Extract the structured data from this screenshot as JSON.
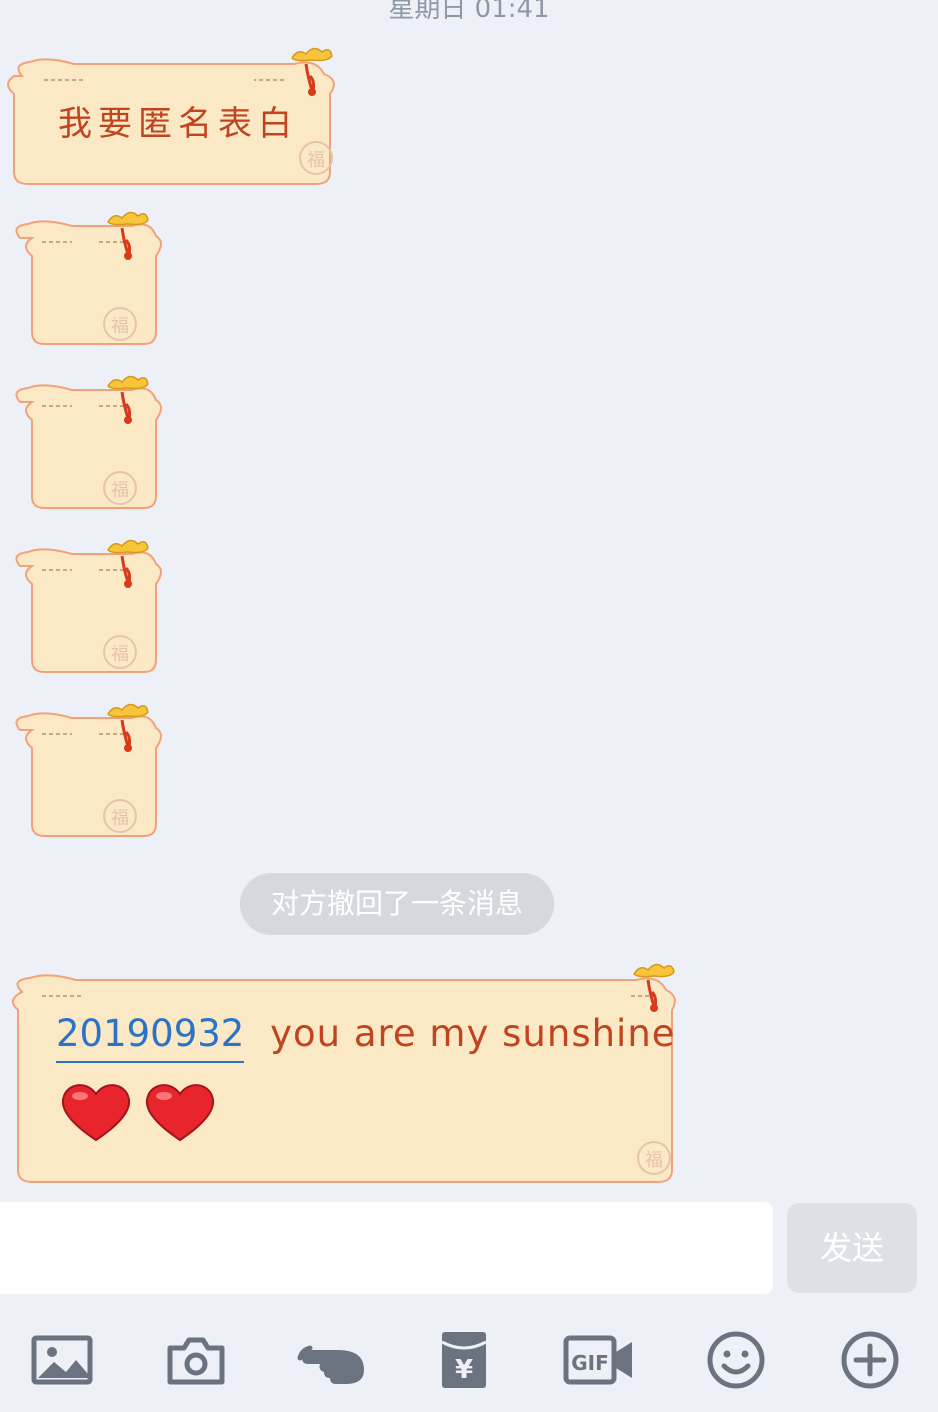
{
  "header": {
    "timestamp": "星期日 01:41"
  },
  "messages": [
    {
      "type": "pouch",
      "text": "我要匿名表白"
    },
    {
      "type": "pouch",
      "text": ""
    },
    {
      "type": "pouch",
      "text": ""
    },
    {
      "type": "pouch",
      "text": ""
    },
    {
      "type": "pouch",
      "text": ""
    },
    {
      "type": "system",
      "text": "对方撤回了一条消息"
    },
    {
      "type": "pouch",
      "mention": "20190932",
      "text": "you are my sunshine",
      "emojis": [
        "heart-emoji",
        "heart-emoji"
      ]
    }
  ],
  "input": {
    "value": "",
    "placeholder": ""
  },
  "send_button": {
    "label": "发送"
  },
  "toolbar": {
    "items": [
      {
        "icon": "image-icon"
      },
      {
        "icon": "camera-icon"
      },
      {
        "icon": "poke-icon"
      },
      {
        "icon": "red-packet-icon"
      },
      {
        "icon": "gif-icon"
      },
      {
        "icon": "emoji-icon"
      },
      {
        "icon": "plus-icon"
      }
    ]
  },
  "colors": {
    "background": "#edf1f7",
    "pouch_fill": "#fbe8c5",
    "pouch_border": "#f2a27a",
    "text_red": "#c0451f",
    "mention_blue": "#2a73c7"
  }
}
